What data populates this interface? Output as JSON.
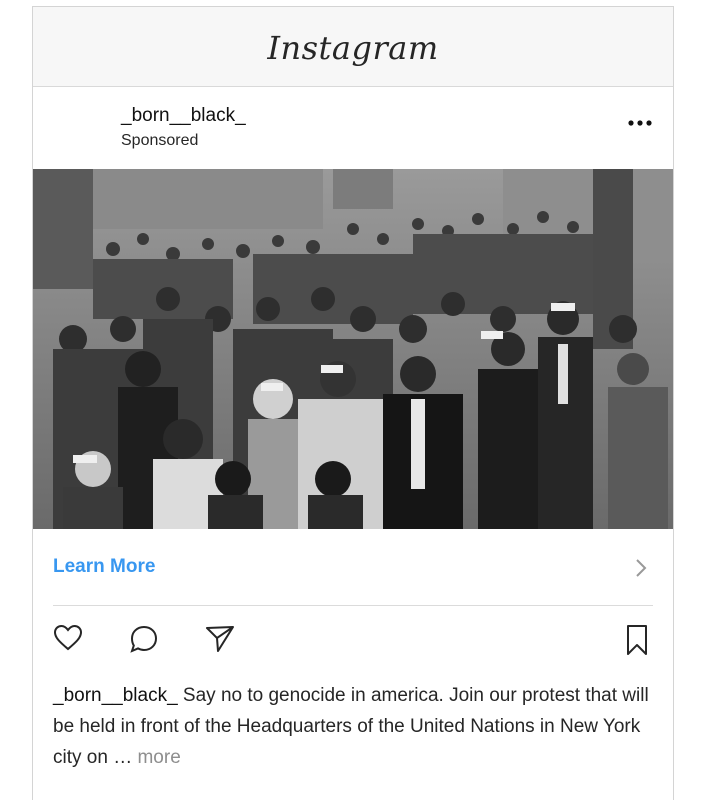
{
  "app": {
    "title": "Instagram"
  },
  "post": {
    "username": "_born__black_",
    "sponsored_label": "Sponsored",
    "more_options_icon": "three-dots-icon",
    "media": {
      "description_icon": "crowd-photo"
    },
    "cta": {
      "label": "Learn More",
      "icon": "chevron-right-icon",
      "color": "#3897f0"
    },
    "actions": {
      "like_icon": "heart-icon",
      "comment_icon": "comment-icon",
      "share_icon": "paper-plane-icon",
      "save_icon": "bookmark-icon"
    },
    "caption": {
      "username": "_born__black_",
      "text": " Say no to genocide in america. Join our protest that will be held in front of the Headquarters of the United Nations in New York city on … ",
      "more_label": "more"
    }
  }
}
